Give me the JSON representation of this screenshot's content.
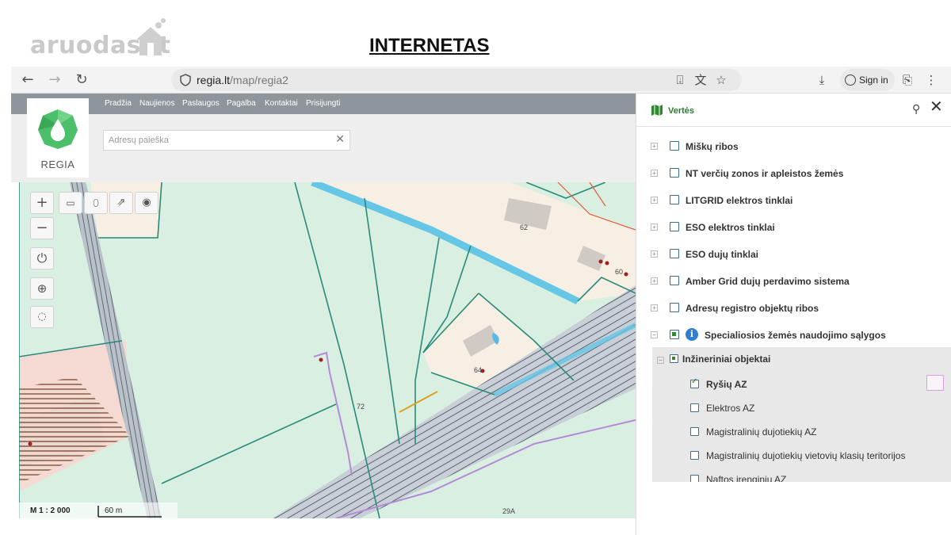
{
  "slide": {
    "watermark": "aruodas",
    "watermark_suffix": ".lt",
    "title": "INTERNETAS"
  },
  "browser": {
    "url_domain": "regia.lt",
    "url_path": "/map/regia2",
    "signin_label": "Sign in"
  },
  "site": {
    "nav": [
      "Pradžia",
      "Naujienos",
      "Paslaugos",
      "Pagalba",
      "Kontaktai",
      "Prisijungti"
    ],
    "logo_text": "REGIA",
    "search_placeholder": "Adresų paieška"
  },
  "map": {
    "scale": "M 1 : 2 000",
    "scale_distance": "60 m",
    "labels": [
      "62",
      "60",
      "72",
      "64",
      "29A"
    ]
  },
  "panel": {
    "title": "Vertės",
    "layers": [
      {
        "label": "Miškų ribos",
        "checked": false
      },
      {
        "label": "NT verčių zonos ir apleistos žemės",
        "checked": false
      },
      {
        "label": "LITGRID elektros tinklai",
        "checked": false
      },
      {
        "label": "ESO elektros tinklai",
        "checked": false
      },
      {
        "label": "ESO dujų tinklai",
        "checked": false
      },
      {
        "label": "Amber Grid dujų perdavimo sistema",
        "checked": false
      },
      {
        "label": "Adresų registro objektų ribos",
        "checked": false
      },
      {
        "label": "Specialiosios žemės naudojimo sąlygos",
        "checked": true
      }
    ],
    "sublayers": [
      {
        "label": "Inžineriniai objektai",
        "checked": true
      },
      {
        "label": "Ryšių AZ",
        "checked": true
      },
      {
        "label": "Elektros AZ",
        "checked": false
      },
      {
        "label": "Magistralinių dujotiekių AZ",
        "checked": false
      },
      {
        "label": "Magistralinių dujotiekių vietovių klasių teritorijos",
        "checked": false
      },
      {
        "label": "Naftos įrenginių AZ",
        "checked": false
      }
    ]
  },
  "colors": {
    "accent_green": "#2f8a2f",
    "nav_gray": "#8e969c",
    "map_green": "#d8efe1",
    "parcel_line": "#2a8a7a"
  }
}
